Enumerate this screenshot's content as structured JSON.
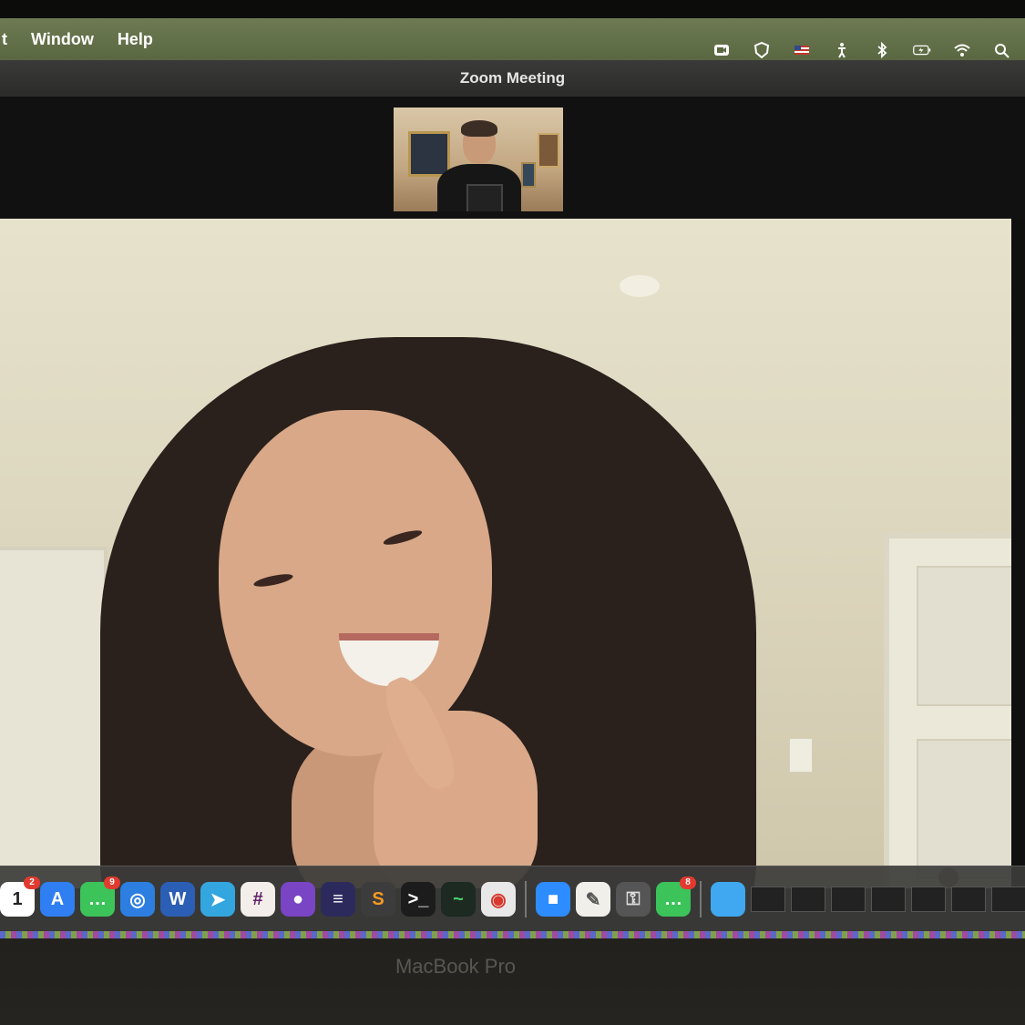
{
  "menubar": {
    "items": [
      "t",
      "Window",
      "Help"
    ],
    "status_icons": [
      "zoom-status-icon",
      "shield-icon",
      "flag-icon",
      "accessibility-icon",
      "bluetooth-icon",
      "battery-icon",
      "wifi-icon",
      "search-icon"
    ]
  },
  "window": {
    "title": "Zoom Meeting"
  },
  "dock": {
    "apps": [
      {
        "name": "calendar-icon",
        "label": "1",
        "badge": "2",
        "color": "#ffffff",
        "text_color": "#222"
      },
      {
        "name": "app-store-icon",
        "label": "A",
        "badge": "",
        "color": "#2f7ff2",
        "text_color": "#fff"
      },
      {
        "name": "messages-icon",
        "label": "…",
        "badge": "9",
        "color": "#3cc35a",
        "text_color": "#fff"
      },
      {
        "name": "safari-icon",
        "label": "◎",
        "badge": "",
        "color": "#2c7fe0",
        "text_color": "#fff"
      },
      {
        "name": "word-icon",
        "label": "W",
        "badge": "",
        "color": "#2b5eb5",
        "text_color": "#fff"
      },
      {
        "name": "telegram-icon",
        "label": "➤",
        "badge": "",
        "color": "#34a6df",
        "text_color": "#fff"
      },
      {
        "name": "slack-icon",
        "label": "#",
        "badge": "",
        "color": "#f3eee9",
        "text_color": "#611f69"
      },
      {
        "name": "github-icon",
        "label": "●",
        "badge": "",
        "color": "#7a45c4",
        "text_color": "#fff"
      },
      {
        "name": "eclipse-icon",
        "label": "≡",
        "badge": "",
        "color": "#2c2a5c",
        "text_color": "#fff"
      },
      {
        "name": "sublime-icon",
        "label": "S",
        "badge": "",
        "color": "#3c3c3c",
        "text_color": "#f59a22"
      },
      {
        "name": "terminal-icon",
        "label": ">_",
        "badge": "",
        "color": "#1c1c1c",
        "text_color": "#fff"
      },
      {
        "name": "activity-monitor-icon",
        "label": "~",
        "badge": "",
        "color": "#1c2a22",
        "text_color": "#48d36a"
      },
      {
        "name": "chrome-icon",
        "label": "◉",
        "badge": "",
        "color": "#e8e8e8",
        "text_color": "#d8382d"
      },
      {
        "name": "zoom-icon",
        "label": "■",
        "badge": "",
        "color": "#2d8cff",
        "text_color": "#fff"
      },
      {
        "name": "textedit-icon",
        "label": "✎",
        "badge": "",
        "color": "#f0efe9",
        "text_color": "#555"
      },
      {
        "name": "keychain-icon",
        "label": "⚿",
        "badge": "",
        "color": "#555555",
        "text_color": "#ddd"
      },
      {
        "name": "imessage-icon",
        "label": "…",
        "badge": "8",
        "color": "#3cc35a",
        "text_color": "#fff"
      }
    ],
    "folder": {
      "name": "downloads-folder-icon",
      "color": "#3fa8f0"
    }
  },
  "laptop": {
    "brand": "MacBook Pro"
  }
}
